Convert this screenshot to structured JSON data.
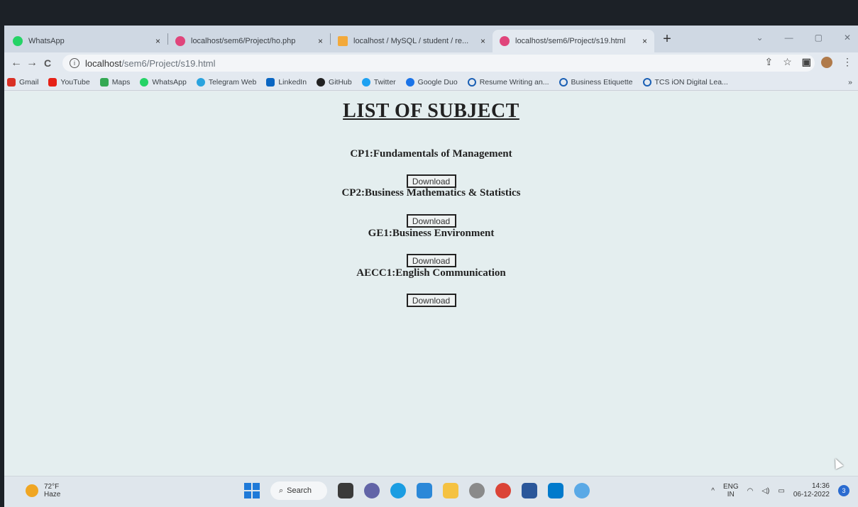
{
  "tabs": [
    {
      "title": "WhatsApp",
      "favicon_color": "#25d366",
      "close": "×"
    },
    {
      "title": "localhost/sem6/Project/ho.php",
      "favicon_color": "#e0457b",
      "close": "×"
    },
    {
      "title": "localhost / MySQL / student / re...",
      "favicon_color": "#f3a93a",
      "close": "×"
    },
    {
      "title": "localhost/sem6/Project/s19.html",
      "favicon_color": "#e0457b",
      "close": "×",
      "active": true
    }
  ],
  "new_tab": "+",
  "window_controls": {
    "minimize": "—",
    "maximize": "▢",
    "close": "✕",
    "dropdown": "⌄"
  },
  "nav": {
    "back": "←",
    "forward": "→",
    "reload": "C"
  },
  "url": {
    "host": "localhost",
    "path": "/sem6/Project/s19.html"
  },
  "toolbar_icons": [
    "share-icon",
    "star-icon",
    "sidepanel-icon",
    "profile-icon",
    "menu-icon"
  ],
  "bookmarks": [
    {
      "label": "Gmail",
      "color": "#d93025"
    },
    {
      "label": "YouTube",
      "color": "#e62117"
    },
    {
      "label": "Maps",
      "color": "#34a853"
    },
    {
      "label": "WhatsApp",
      "color": "#25d366"
    },
    {
      "label": "Telegram Web",
      "color": "#2aa3de"
    },
    {
      "label": "LinkedIn",
      "color": "#0a66c2"
    },
    {
      "label": "GitHub",
      "color": "#222222"
    },
    {
      "label": "Twitter",
      "color": "#1da1f2"
    },
    {
      "label": "Google Duo",
      "color": "#1a73e8"
    },
    {
      "label": "Resume Writing an...",
      "color": "#1a5fb4"
    },
    {
      "label": "Business Etiquette",
      "color": "#1a5fb4"
    },
    {
      "label": "TCS iON Digital Lea...",
      "color": "#1a5fb4"
    }
  ],
  "bookmarks_more": "»",
  "page": {
    "heading": "LIST OF SUBJECT",
    "subjects": [
      {
        "name": "CP1:Fundamentals of Management",
        "button": "Download"
      },
      {
        "name": "CP2:Business Mathematics & Statistics",
        "button": "Download"
      },
      {
        "name": "GE1:Business Environment",
        "button": "Download"
      },
      {
        "name": "AECC1:English Communication",
        "button": "Download"
      }
    ]
  },
  "taskbar": {
    "weather_temp": "72°F",
    "weather_desc": "Haze",
    "search_label": "Search",
    "apps": [
      {
        "name": "file-explorer-dark",
        "color": "#3a3a3a"
      },
      {
        "name": "teams",
        "color": "#6264a7"
      },
      {
        "name": "edge",
        "color": "#1b9de2"
      },
      {
        "name": "store",
        "color": "#2b88d8"
      },
      {
        "name": "folder",
        "color": "#f5c242"
      },
      {
        "name": "dell",
        "color": "#8a8a8a"
      },
      {
        "name": "chrome",
        "color": "#db4437"
      },
      {
        "name": "word",
        "color": "#2b579a"
      },
      {
        "name": "vscode",
        "color": "#007acc"
      },
      {
        "name": "paint",
        "color": "#5aa9e6"
      }
    ],
    "lang_top": "ENG",
    "lang_bottom": "IN",
    "time": "14:36",
    "date": "06-12-2022",
    "notifications": "3"
  }
}
